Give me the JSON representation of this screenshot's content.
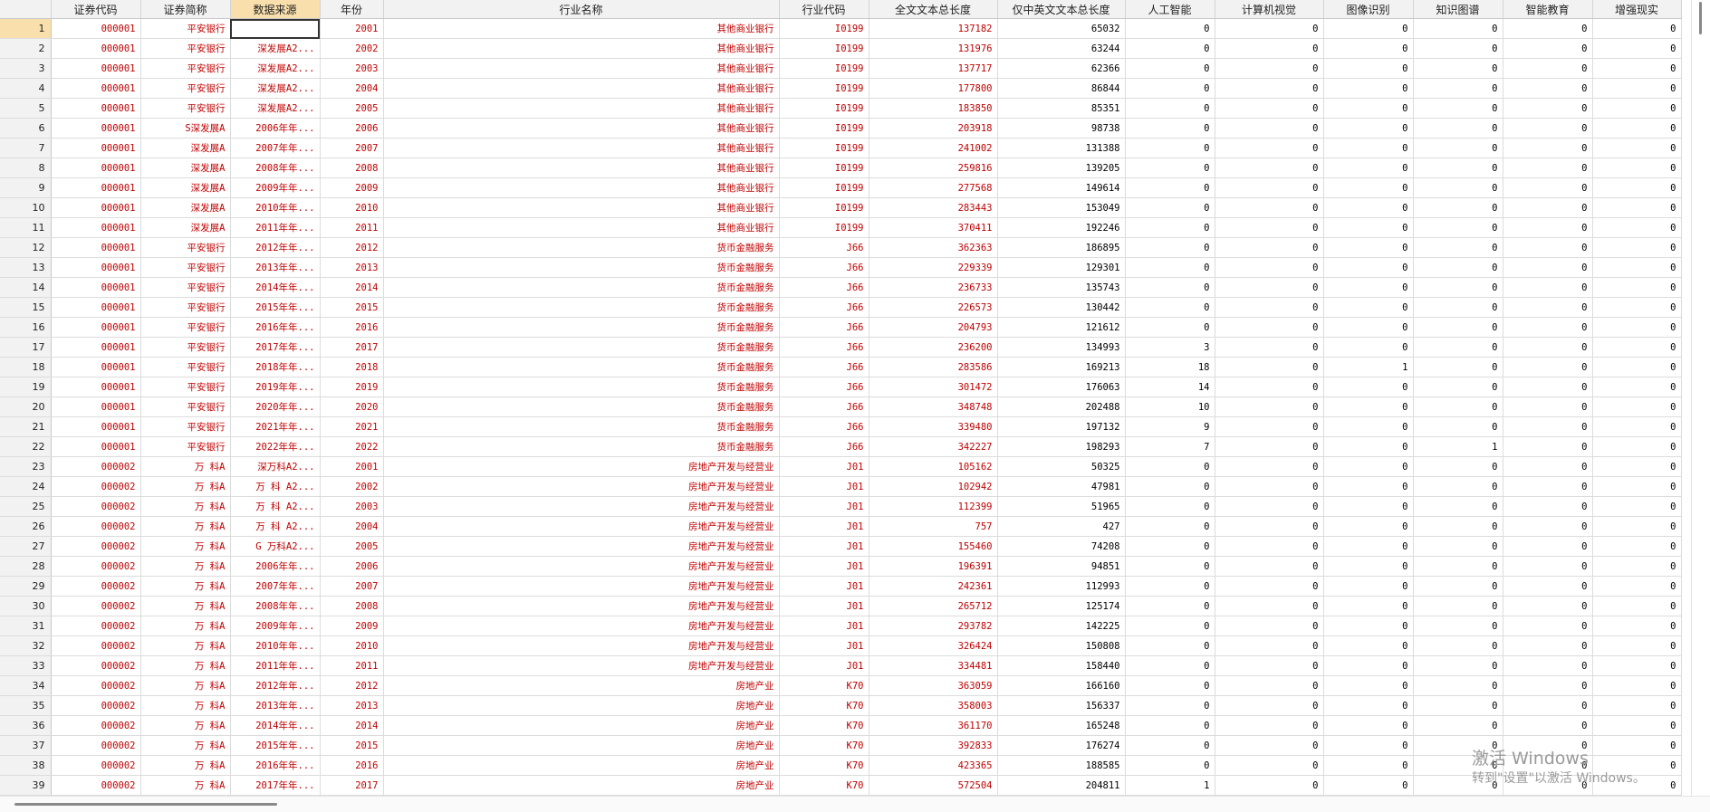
{
  "columns": [
    "证券代码",
    "证券简称",
    "数据来源",
    "年份",
    "行业名称",
    "行业代码",
    "全文文本总长度",
    "仅中英文文本总长度",
    "人工智能",
    "计算机视觉",
    "图像识别",
    "知识图谱",
    "智能教育",
    "增强现实"
  ],
  "selected_column": "数据来源",
  "rows": [
    [
      "1",
      "000001",
      "平安银行",
      "",
      "2001",
      "其他商业银行",
      "I0199",
      "137182",
      "65032",
      "0",
      "0",
      "0",
      "0",
      "0",
      "0"
    ],
    [
      "2",
      "000001",
      "平安银行",
      "深发展A2...",
      "2002",
      "其他商业银行",
      "I0199",
      "131976",
      "63244",
      "0",
      "0",
      "0",
      "0",
      "0",
      "0"
    ],
    [
      "3",
      "000001",
      "平安银行",
      "深发展A2...",
      "2003",
      "其他商业银行",
      "I0199",
      "137717",
      "62366",
      "0",
      "0",
      "0",
      "0",
      "0",
      "0"
    ],
    [
      "4",
      "000001",
      "平安银行",
      "深发展A2...",
      "2004",
      "其他商业银行",
      "I0199",
      "177800",
      "86844",
      "0",
      "0",
      "0",
      "0",
      "0",
      "0"
    ],
    [
      "5",
      "000001",
      "平安银行",
      "深发展A2...",
      "2005",
      "其他商业银行",
      "I0199",
      "183850",
      "85351",
      "0",
      "0",
      "0",
      "0",
      "0",
      "0"
    ],
    [
      "6",
      "000001",
      "S深发展A",
      "2006年年...",
      "2006",
      "其他商业银行",
      "I0199",
      "203918",
      "98738",
      "0",
      "0",
      "0",
      "0",
      "0",
      "0"
    ],
    [
      "7",
      "000001",
      "深发展A",
      "2007年年...",
      "2007",
      "其他商业银行",
      "I0199",
      "241002",
      "131388",
      "0",
      "0",
      "0",
      "0",
      "0",
      "0"
    ],
    [
      "8",
      "000001",
      "深发展A",
      "2008年年...",
      "2008",
      "其他商业银行",
      "I0199",
      "259816",
      "139205",
      "0",
      "0",
      "0",
      "0",
      "0",
      "0"
    ],
    [
      "9",
      "000001",
      "深发展A",
      "2009年年...",
      "2009",
      "其他商业银行",
      "I0199",
      "277568",
      "149614",
      "0",
      "0",
      "0",
      "0",
      "0",
      "0"
    ],
    [
      "10",
      "000001",
      "深发展A",
      "2010年年...",
      "2010",
      "其他商业银行",
      "I0199",
      "283443",
      "153049",
      "0",
      "0",
      "0",
      "0",
      "0",
      "0"
    ],
    [
      "11",
      "000001",
      "深发展A",
      "2011年年...",
      "2011",
      "其他商业银行",
      "I0199",
      "370411",
      "192246",
      "0",
      "0",
      "0",
      "0",
      "0",
      "0"
    ],
    [
      "12",
      "000001",
      "平安银行",
      "2012年年...",
      "2012",
      "货币金融服务",
      "J66",
      "362363",
      "186895",
      "0",
      "0",
      "0",
      "0",
      "0",
      "0"
    ],
    [
      "13",
      "000001",
      "平安银行",
      "2013年年...",
      "2013",
      "货币金融服务",
      "J66",
      "229339",
      "129301",
      "0",
      "0",
      "0",
      "0",
      "0",
      "0"
    ],
    [
      "14",
      "000001",
      "平安银行",
      "2014年年...",
      "2014",
      "货币金融服务",
      "J66",
      "236733",
      "135743",
      "0",
      "0",
      "0",
      "0",
      "0",
      "0"
    ],
    [
      "15",
      "000001",
      "平安银行",
      "2015年年...",
      "2015",
      "货币金融服务",
      "J66",
      "226573",
      "130442",
      "0",
      "0",
      "0",
      "0",
      "0",
      "0"
    ],
    [
      "16",
      "000001",
      "平安银行",
      "2016年年...",
      "2016",
      "货币金融服务",
      "J66",
      "204793",
      "121612",
      "0",
      "0",
      "0",
      "0",
      "0",
      "0"
    ],
    [
      "17",
      "000001",
      "平安银行",
      "2017年年...",
      "2017",
      "货币金融服务",
      "J66",
      "236200",
      "134993",
      "3",
      "0",
      "0",
      "0",
      "0",
      "0"
    ],
    [
      "18",
      "000001",
      "平安银行",
      "2018年年...",
      "2018",
      "货币金融服务",
      "J66",
      "283586",
      "169213",
      "18",
      "0",
      "1",
      "0",
      "0",
      "0"
    ],
    [
      "19",
      "000001",
      "平安银行",
      "2019年年...",
      "2019",
      "货币金融服务",
      "J66",
      "301472",
      "176063",
      "14",
      "0",
      "0",
      "0",
      "0",
      "0"
    ],
    [
      "20",
      "000001",
      "平安银行",
      "2020年年...",
      "2020",
      "货币金融服务",
      "J66",
      "348748",
      "202488",
      "10",
      "0",
      "0",
      "0",
      "0",
      "0"
    ],
    [
      "21",
      "000001",
      "平安银行",
      "2021年年...",
      "2021",
      "货币金融服务",
      "J66",
      "339480",
      "197132",
      "9",
      "0",
      "0",
      "0",
      "0",
      "0"
    ],
    [
      "22",
      "000001",
      "平安银行",
      "2022年年...",
      "2022",
      "货币金融服务",
      "J66",
      "342227",
      "198293",
      "7",
      "0",
      "0",
      "1",
      "0",
      "0"
    ],
    [
      "23",
      "000002",
      "万 科A",
      "深万科A2...",
      "2001",
      "房地产开发与经营业",
      "J01",
      "105162",
      "50325",
      "0",
      "0",
      "0",
      "0",
      "0",
      "0"
    ],
    [
      "24",
      "000002",
      "万 科A",
      "万 科 A2...",
      "2002",
      "房地产开发与经营业",
      "J01",
      "102942",
      "47981",
      "0",
      "0",
      "0",
      "0",
      "0",
      "0"
    ],
    [
      "25",
      "000002",
      "万 科A",
      "万 科 A2...",
      "2003",
      "房地产开发与经营业",
      "J01",
      "112399",
      "51965",
      "0",
      "0",
      "0",
      "0",
      "0",
      "0"
    ],
    [
      "26",
      "000002",
      "万 科A",
      "万 科 A2...",
      "2004",
      "房地产开发与经营业",
      "J01",
      "757",
      "427",
      "0",
      "0",
      "0",
      "0",
      "0",
      "0"
    ],
    [
      "27",
      "000002",
      "万 科A",
      "G 万科A2...",
      "2005",
      "房地产开发与经营业",
      "J01",
      "155460",
      "74208",
      "0",
      "0",
      "0",
      "0",
      "0",
      "0"
    ],
    [
      "28",
      "000002",
      "万 科A",
      "2006年年...",
      "2006",
      "房地产开发与经营业",
      "J01",
      "196391",
      "94851",
      "0",
      "0",
      "0",
      "0",
      "0",
      "0"
    ],
    [
      "29",
      "000002",
      "万 科A",
      "2007年年...",
      "2007",
      "房地产开发与经营业",
      "J01",
      "242361",
      "112993",
      "0",
      "0",
      "0",
      "0",
      "0",
      "0"
    ],
    [
      "30",
      "000002",
      "万 科A",
      "2008年年...",
      "2008",
      "房地产开发与经营业",
      "J01",
      "265712",
      "125174",
      "0",
      "0",
      "0",
      "0",
      "0",
      "0"
    ],
    [
      "31",
      "000002",
      "万 科A",
      "2009年年...",
      "2009",
      "房地产开发与经营业",
      "J01",
      "293782",
      "142225",
      "0",
      "0",
      "0",
      "0",
      "0",
      "0"
    ],
    [
      "32",
      "000002",
      "万 科A",
      "2010年年...",
      "2010",
      "房地产开发与经营业",
      "J01",
      "326424",
      "150808",
      "0",
      "0",
      "0",
      "0",
      "0",
      "0"
    ],
    [
      "33",
      "000002",
      "万 科A",
      "2011年年...",
      "2011",
      "房地产开发与经营业",
      "J01",
      "334481",
      "158440",
      "0",
      "0",
      "0",
      "0",
      "0",
      "0"
    ],
    [
      "34",
      "000002",
      "万 科A",
      "2012年年...",
      "2012",
      "房地产业",
      "K70",
      "363059",
      "166160",
      "0",
      "0",
      "0",
      "0",
      "0",
      "0"
    ],
    [
      "35",
      "000002",
      "万 科A",
      "2013年年...",
      "2013",
      "房地产业",
      "K70",
      "358003",
      "156337",
      "0",
      "0",
      "0",
      "0",
      "0",
      "0"
    ],
    [
      "36",
      "000002",
      "万 科A",
      "2014年年...",
      "2014",
      "房地产业",
      "K70",
      "361170",
      "165248",
      "0",
      "0",
      "0",
      "0",
      "0",
      "0"
    ],
    [
      "37",
      "000002",
      "万 科A",
      "2015年年...",
      "2015",
      "房地产业",
      "K70",
      "392833",
      "176274",
      "0",
      "0",
      "0",
      "0",
      "0",
      "0"
    ],
    [
      "38",
      "000002",
      "万 科A",
      "2016年年...",
      "2016",
      "房地产业",
      "K70",
      "423365",
      "188585",
      "0",
      "0",
      "0",
      "0",
      "0",
      "0"
    ],
    [
      "39",
      "000002",
      "万 科A",
      "2017年年...",
      "2017",
      "房地产业",
      "K70",
      "572504",
      "204811",
      "1",
      "0",
      "0",
      "0",
      "0",
      "0"
    ]
  ],
  "watermark": {
    "line1": "激活 Windows",
    "line2": "转到\"设置\"以激活 Windows。"
  },
  "colors": {
    "text_string": "#c00000",
    "text_numeric": "#000000",
    "header_bg": "#f2f2f2",
    "selected_header_bg": "#f8dfac"
  }
}
